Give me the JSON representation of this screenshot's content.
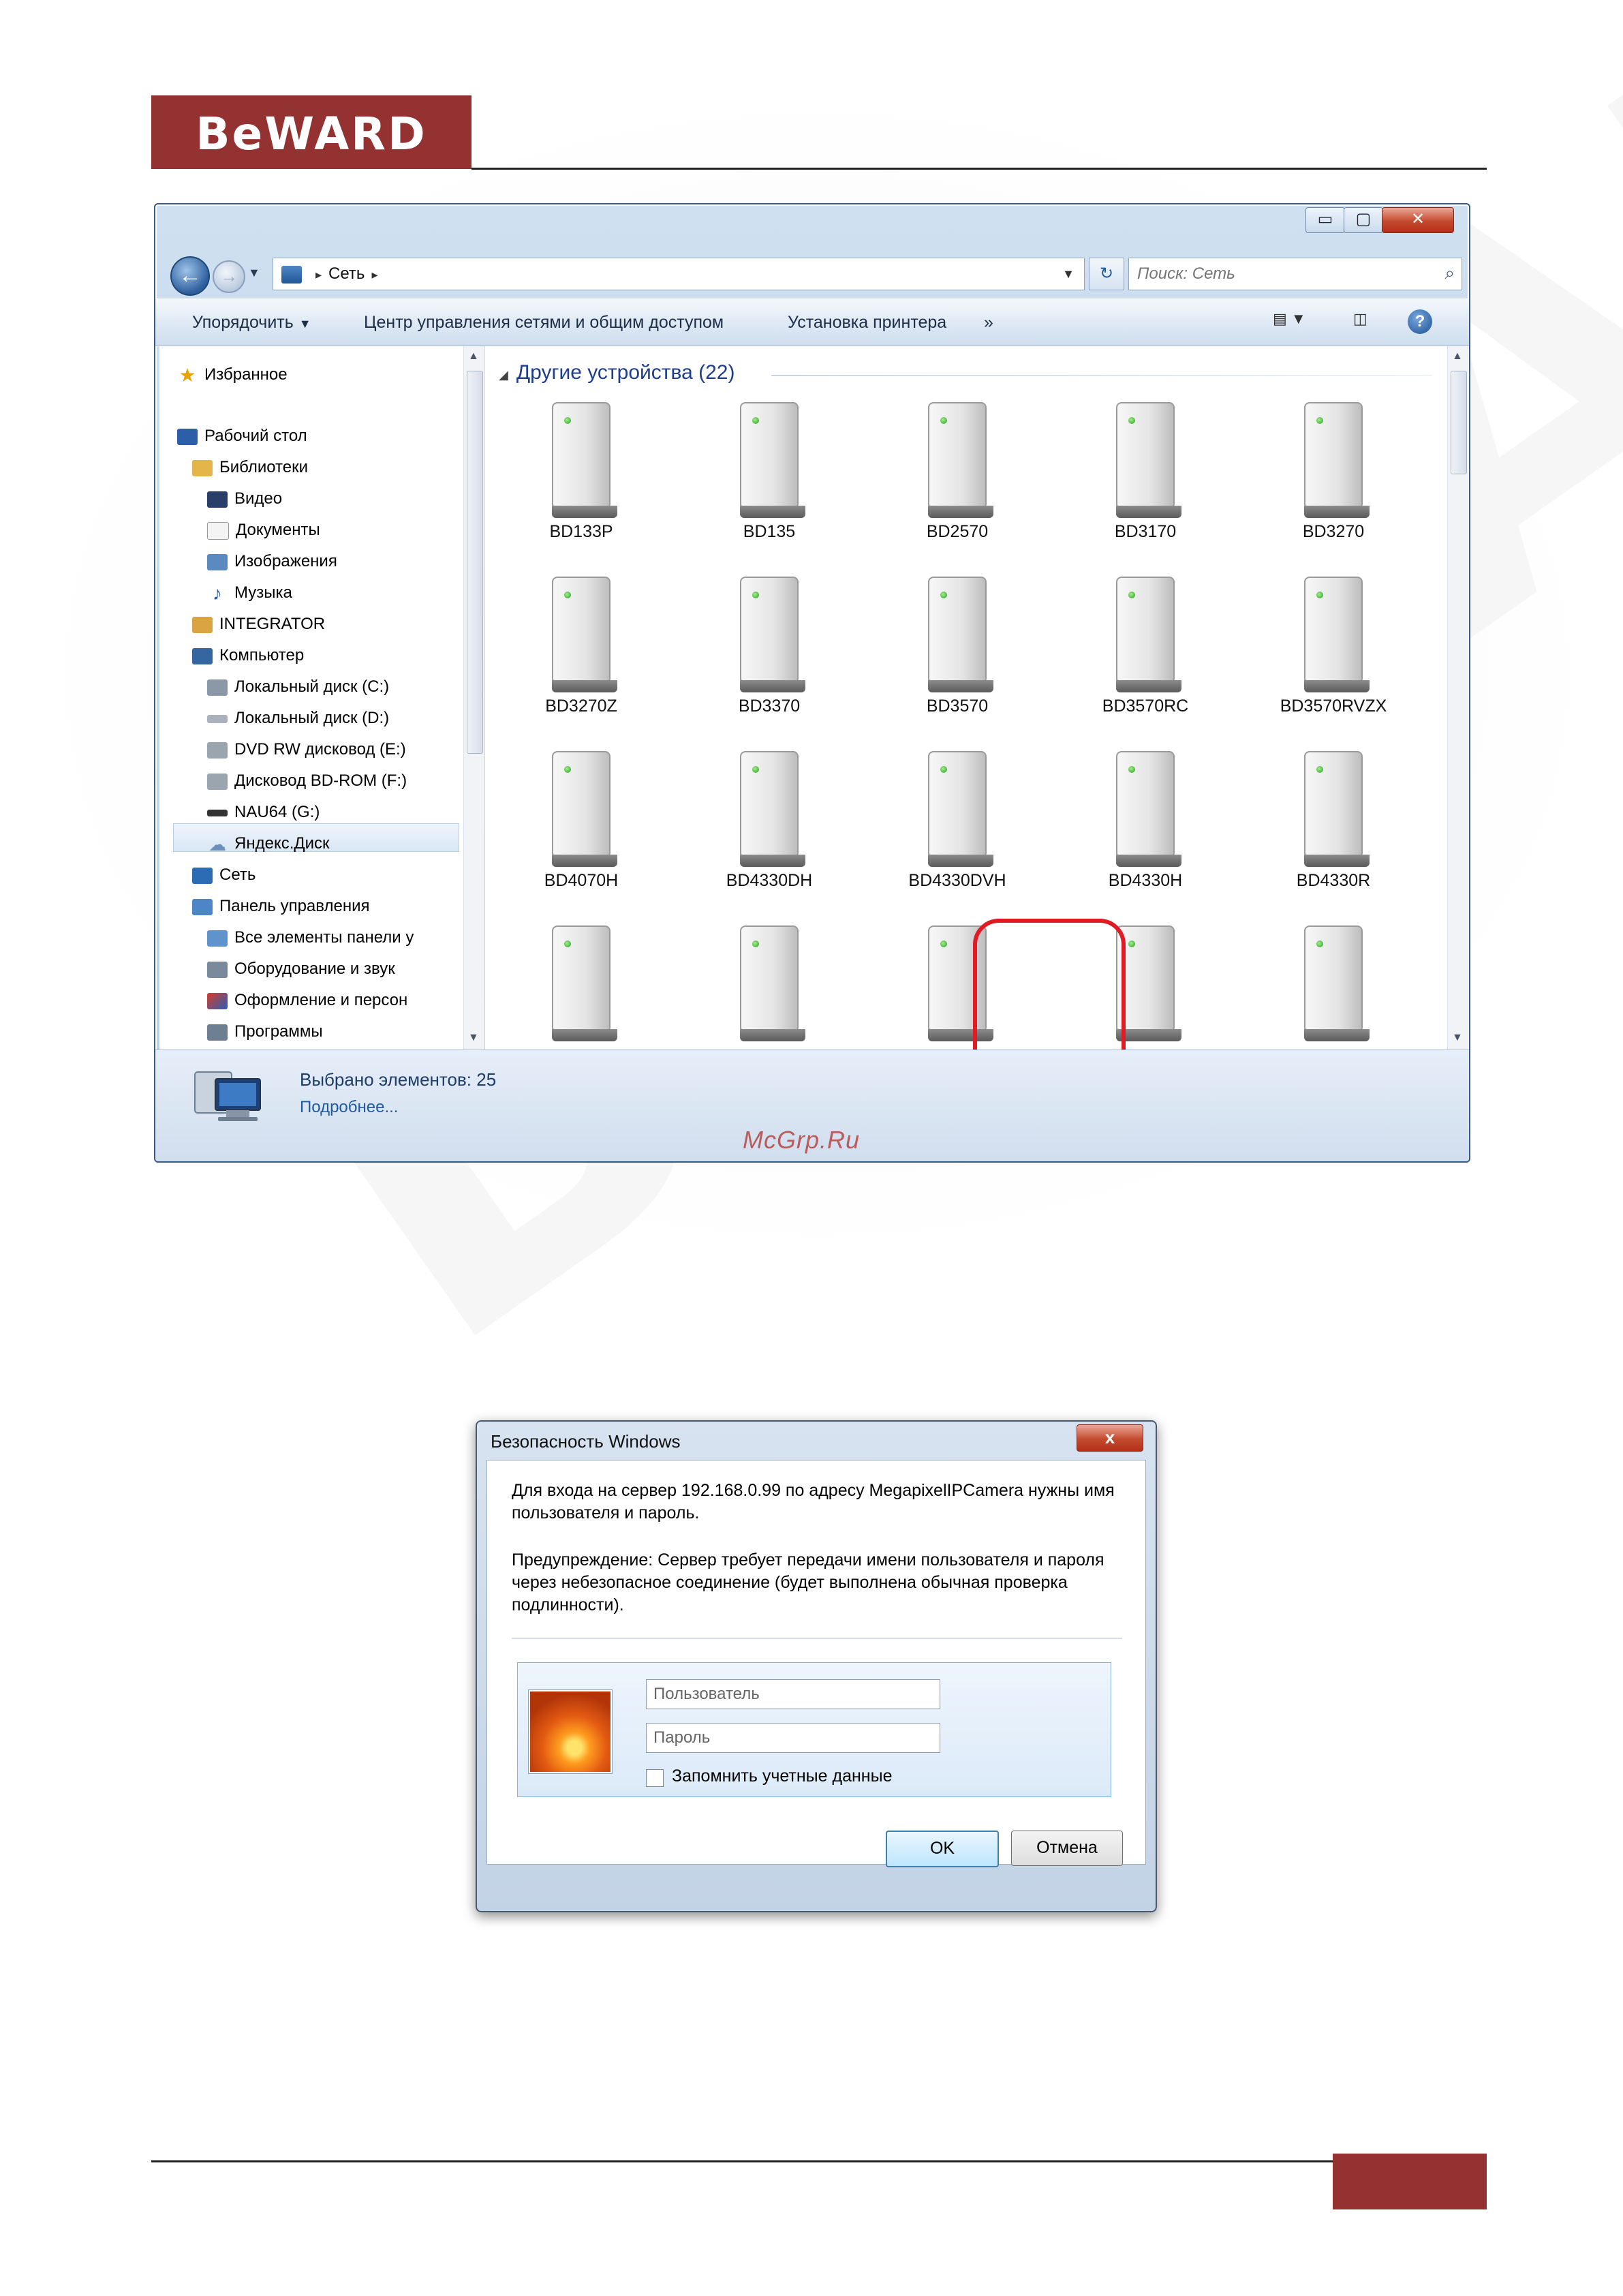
{
  "header": {
    "logo_text": "BeWARD"
  },
  "watermark": {
    "text": "BeWARD"
  },
  "explorer": {
    "window_controls": {
      "minimize": "▭",
      "maximize": "▢",
      "close": "✕"
    },
    "address": {
      "location": "Сеть",
      "sep": "▸"
    },
    "search_placeholder": "Поиск: Сеть",
    "toolbar": {
      "organize": "Упорядочить",
      "network_center": "Центр управления сетями и общим доступом",
      "add_printer": "Установка принтера",
      "more": "»"
    },
    "sidebar": {
      "favorites": "Избранное",
      "desktop": "Рабочий стол",
      "libraries": "Библиотеки",
      "video": "Видео",
      "documents": "Документы",
      "images": "Изображения",
      "music": "Музыка",
      "integrator": "INTEGRATOR",
      "computer": "Компьютер",
      "disk_c": "Локальный диск (C:)",
      "disk_d": "Локальный диск (D:)",
      "dvd_e": "DVD RW дисковод (E:)",
      "bdrom_f": "Дисковод BD-ROM (F:)",
      "nau_g": "NAU64 (G:)",
      "yandex": "Яндекс.Диск",
      "network": "Сеть",
      "control_panel": "Панель управления",
      "cp_all": "Все элементы панели у",
      "cp_hardware": "Оборудование и звук",
      "cp_appearance": "Оформление и персон",
      "cp_programs": "Программы"
    },
    "group_header": "Другие устройства (22)",
    "devices": [
      "BD133P",
      "BD135",
      "BD2570",
      "BD3170",
      "BD3270",
      "BD3270Z",
      "BD3370",
      "BD3570",
      "BD3570RC",
      "BD3570RVZX",
      "BD4070H",
      "BD4330DH",
      "BD4330DVH",
      "BD4330H",
      "BD4330R",
      "",
      "",
      "",
      "",
      ""
    ],
    "status": {
      "selected": "Выбрано элементов: 25",
      "more": "Подробнее..."
    }
  },
  "watermark_site": "McGrp.Ru",
  "dialog": {
    "title": "Безопасность Windows",
    "close": "x",
    "message": "Для входа на сервер 192.168.0.99 по адресу MegapixelIPCamera нужны имя пользователя и пароль.",
    "warning": "Предупреждение: Сервер требует передачи имени пользователя и пароля через небезопасное соединение (будет выполнена обычная проверка подлинности).",
    "username_placeholder": "Пользователь",
    "password_placeholder": "Пароль",
    "remember": "Запомнить учетные данные",
    "ok": "OK",
    "cancel": "Отмена"
  }
}
